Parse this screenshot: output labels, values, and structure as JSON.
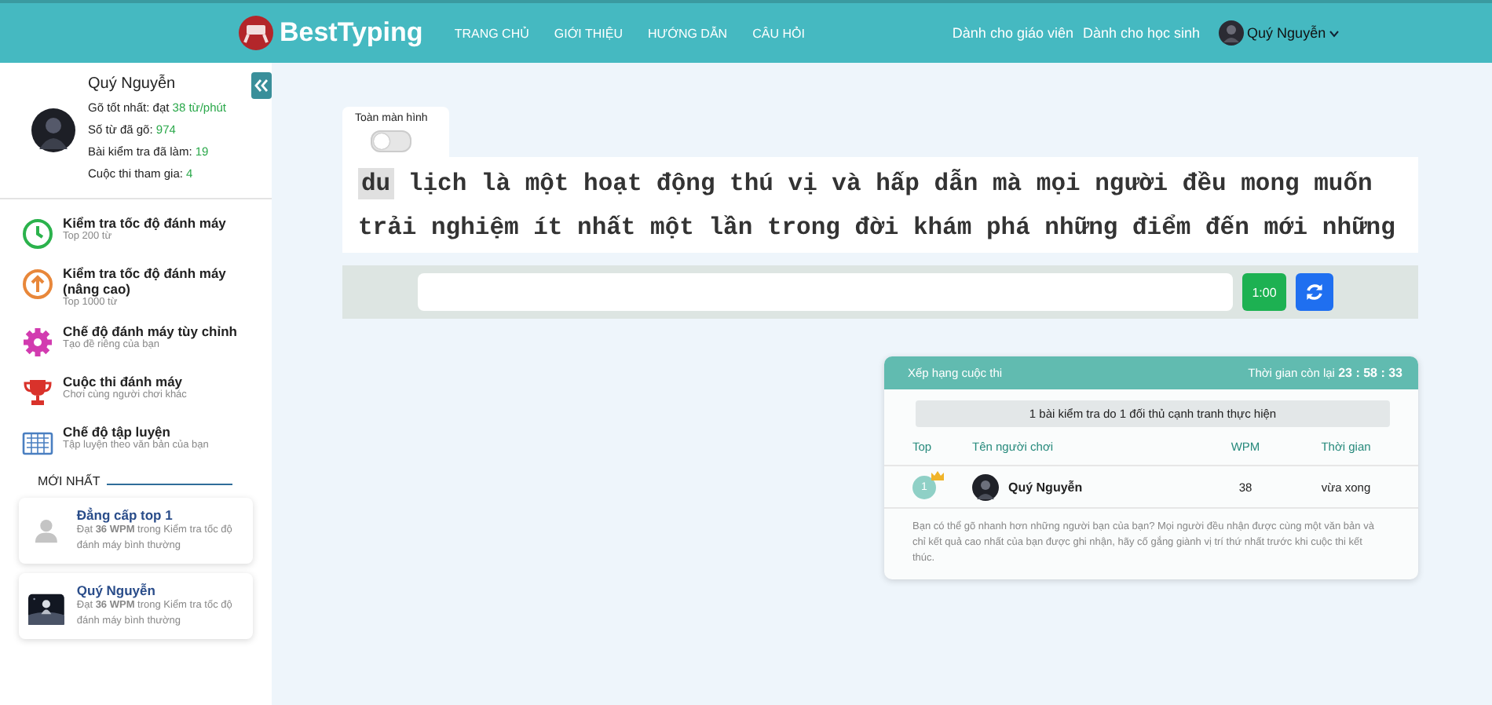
{
  "header": {
    "brand": "BestTyping",
    "nav": [
      "TRANG CHỦ",
      "GIỚI THIỆU",
      "HƯỚNG DẪN",
      "CÂU HỎI"
    ],
    "links": [
      "Dành cho giáo viên",
      "Dành cho học sinh"
    ],
    "user": "Quý Nguyễn"
  },
  "profile": {
    "name": "Quý Nguyễn",
    "stats": [
      {
        "label": "Gõ tốt nhất: đạt",
        "value": "38 từ/phút"
      },
      {
        "label": "Số từ đã gõ:",
        "value": "974"
      },
      {
        "label": "Bài kiểm tra đã làm:",
        "value": "19"
      },
      {
        "label": "Cuộc thi tham gia:",
        "value": "4"
      }
    ]
  },
  "modes": [
    {
      "title": "Kiểm tra tốc độ đánh máy",
      "subtitle": "Top 200 từ"
    },
    {
      "title": "Kiểm tra tốc độ đánh máy (nâng cao)",
      "subtitle": "Top 1000 từ"
    },
    {
      "title": "Chế độ đánh máy tùy chỉnh",
      "subtitle": "Tạo đề riêng của bạn"
    },
    {
      "title": "Cuộc thi đánh máy",
      "subtitle": "Chơi cùng người chơi khác"
    },
    {
      "title": "Chế độ tập luyện",
      "subtitle": "Tập luyện theo văn bản của bạn"
    }
  ],
  "latest": {
    "heading": "MỚI NHẤT",
    "items": [
      {
        "kind": "placeholder",
        "title": "Đẳng cấp top 1",
        "text": "Đạt **36 WPM** trong Kiểm tra tốc độ đánh máy bình thường"
      },
      {
        "kind": "picture",
        "title": "Quý Nguyễn",
        "text": "Đạt **36 WPM** trong Kiểm tra tốc độ đánh máy bình thường"
      }
    ]
  },
  "fullscreen": {
    "label": "Toàn màn hình",
    "on": false
  },
  "typing_text": {
    "lines": [
      {
        "current_word": "du",
        "text": "lịch là một hoạt động thú vị và hấp dẫn mà mọi người đều mong muốn"
      },
      {
        "text": "trải nghiệm ít nhất một lần trong đời khám phá những điểm đến mới những"
      }
    ]
  },
  "timer": "1:00",
  "leaderboard": {
    "title": "Xếp hạng cuộc thi",
    "time_label": "Thời gian còn lại",
    "time": "23 : 58 : 33",
    "summary": "1 bài kiểm tra do 1 đối thủ cạnh tranh thực hiện",
    "columns": [
      "Top",
      "Tên người chơi",
      "WPM",
      "Thời gian"
    ],
    "rows": [
      {
        "rank": "1",
        "name": "Quý Nguyễn",
        "wpm": "38",
        "time": "vừa xong"
      }
    ],
    "note": "Bạn có thể gõ nhanh hơn những người bạn của bạn? Mọi người đều nhận được cùng một văn bản và chỉ kết quả cao nhất của bạn được ghi nhận, hãy cố gắng giành vị trí thứ nhất trước khi cuộc thi kết thúc."
  }
}
